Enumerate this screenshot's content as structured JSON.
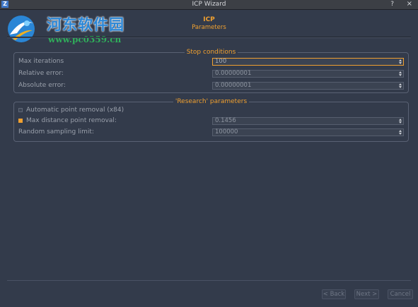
{
  "window": {
    "title": "ICP Wizard",
    "app_icon_letter": "Z",
    "help_symbol": "?",
    "close_symbol": "×"
  },
  "watermark": {
    "line1": "河东软件园",
    "line2": "www.pc0359.cn"
  },
  "header": {
    "title": "ICP",
    "subtitle": "Parameters"
  },
  "stop_conditions": {
    "title": "Stop conditions",
    "max_iterations": {
      "label": "Max iterations",
      "value": "100"
    },
    "relative_error": {
      "label": "Relative error:",
      "value": "0.00000001"
    },
    "absolute_error": {
      "label": "Absolute error:",
      "value": "0.00000001"
    }
  },
  "research": {
    "title": "'Research' parameters",
    "automatic_point_removal": {
      "label": "Automatic point removal (x84)",
      "checked": false
    },
    "max_distance": {
      "label": "Max distance point removal:",
      "checked": true,
      "value": "0.1456"
    },
    "random_sampling": {
      "label": "Random sampling limit:",
      "value": "100000"
    }
  },
  "footer": {
    "back_label": "< Back",
    "next_label": "Next >",
    "cancel_label": "Cancel"
  },
  "colors": {
    "accent": "#f0a030",
    "background": "#333b4b"
  }
}
